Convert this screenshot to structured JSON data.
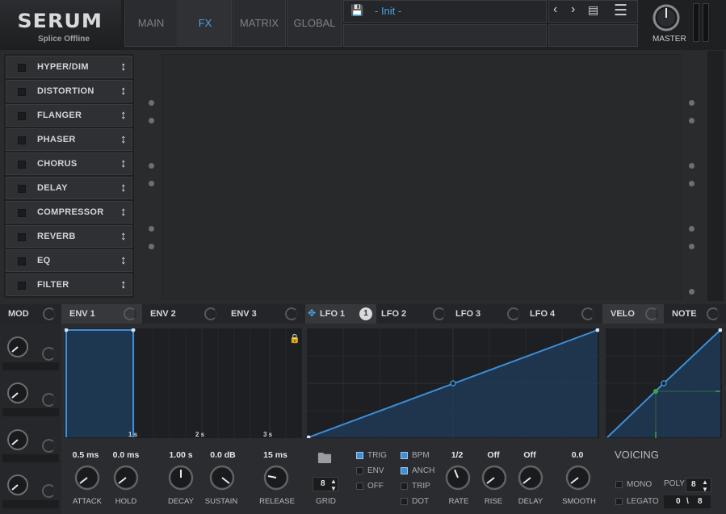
{
  "header": {
    "brand": "SERUM",
    "subtitle": "Splice Offline",
    "tabs": [
      "MAIN",
      "FX",
      "MATRIX",
      "GLOBAL"
    ],
    "active_tab": "FX",
    "preset_name": "- Init -",
    "master_label": "MASTER"
  },
  "fx": {
    "modules": [
      "HYPER/DIM",
      "DISTORTION",
      "FLANGER",
      "PHASER",
      "CHORUS",
      "DELAY",
      "COMPRESSOR",
      "REVERB",
      "EQ",
      "FILTER"
    ]
  },
  "mod_tabs": {
    "mod": "MOD",
    "env1": "ENV 1",
    "env2": "ENV 2",
    "env3": "ENV 3",
    "lfo1": "LFO 1",
    "lfo1_badge": "1",
    "lfo2": "LFO 2",
    "lfo3": "LFO 3",
    "lfo4": "LFO 4",
    "velo": "VELO",
    "note": "NOTE"
  },
  "env": {
    "time_markers": [
      "1 s",
      "2 s",
      "3 s"
    ],
    "knobs": [
      {
        "label": "ATTACK",
        "value": "0.5 ms"
      },
      {
        "label": "HOLD",
        "value": "0.0 ms"
      },
      {
        "label": "DECAY",
        "value": "1.00 s"
      },
      {
        "label": "SUSTAIN",
        "value": "0.0 dB"
      },
      {
        "label": "RELEASE",
        "value": "15 ms"
      }
    ]
  },
  "lfo": {
    "grid_label": "GRID",
    "grid_value": "8",
    "options_col1": [
      {
        "label": "TRIG",
        "checked": true
      },
      {
        "label": "ENV",
        "checked": false
      },
      {
        "label": "OFF",
        "checked": false
      }
    ],
    "options_col2": [
      {
        "label": "BPM",
        "checked": true
      },
      {
        "label": "ANCH",
        "checked": true
      },
      {
        "label": "TRIP",
        "checked": false
      },
      {
        "label": "DOT",
        "checked": false
      }
    ],
    "knobs": [
      {
        "label": "RATE",
        "value": "1/2"
      },
      {
        "label": "RISE",
        "value": "Off"
      },
      {
        "label": "DELAY",
        "value": "Off"
      },
      {
        "label": "SMOOTH",
        "value": "0.0"
      }
    ]
  },
  "voicing": {
    "title": "VOICING",
    "mono_label": "MONO",
    "legato_label": "LEGATO",
    "poly_label": "POLY",
    "poly_value": "8",
    "voice_count": "0",
    "voice_max": "8"
  },
  "colors": {
    "accent": "#4aa3e8",
    "envelope_line": "#3b8fd9",
    "point": "#3fa34d"
  }
}
